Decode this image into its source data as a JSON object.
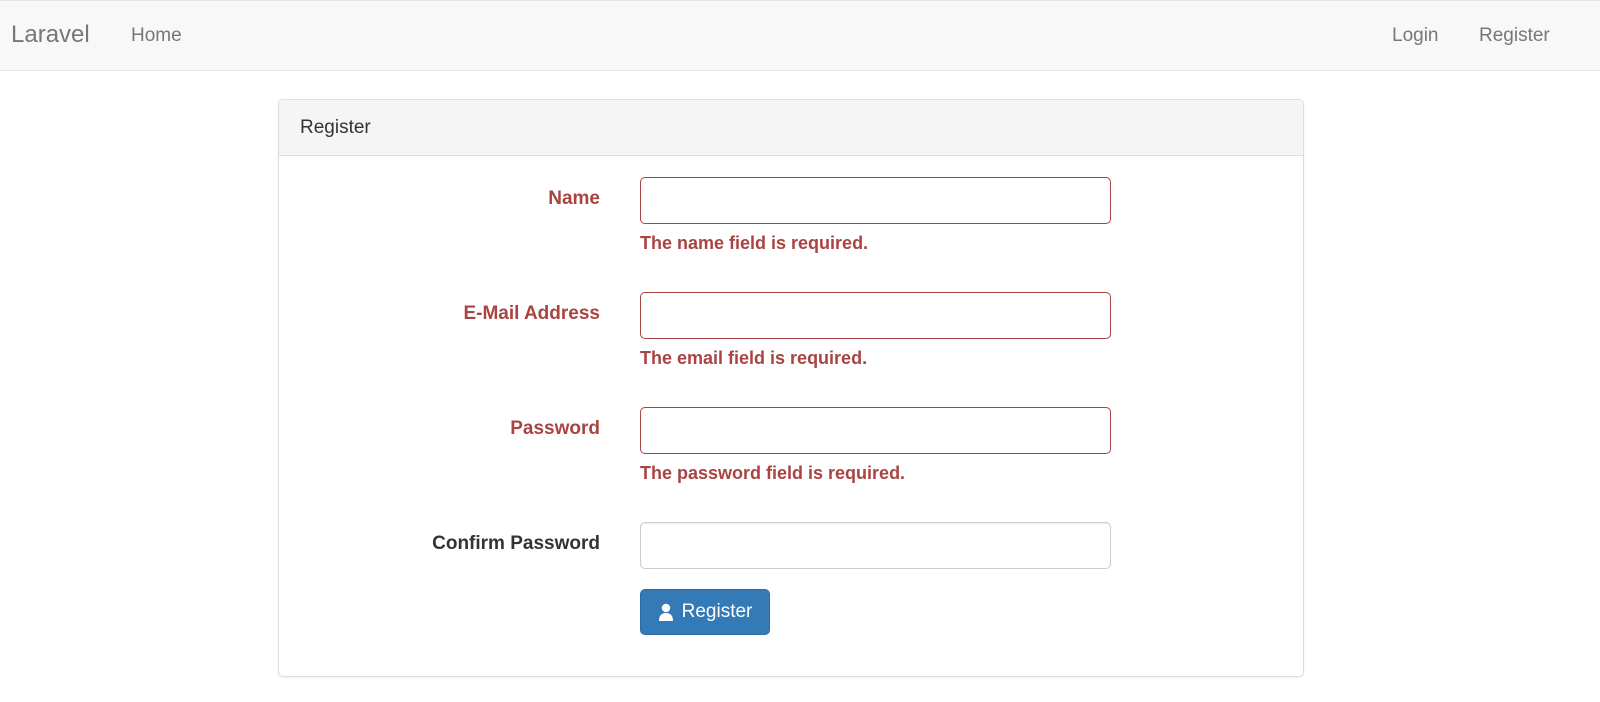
{
  "navbar": {
    "brand": "Laravel",
    "home_label": "Home",
    "login_label": "Login",
    "register_label": "Register"
  },
  "panel": {
    "title": "Register"
  },
  "form": {
    "name": {
      "label": "Name",
      "error": "The name field is required.",
      "value": ""
    },
    "email": {
      "label": "E-Mail Address",
      "error": "The email field is required.",
      "value": ""
    },
    "password": {
      "label": "Password",
      "error": "The password field is required.",
      "value": ""
    },
    "confirm": {
      "label": "Confirm Password",
      "value": ""
    },
    "submit_label": "Register",
    "submit_icon": "user-icon"
  },
  "colors": {
    "error": "#a94442",
    "primary": "#337ab7",
    "navbar_bg": "#f8f8f8"
  }
}
